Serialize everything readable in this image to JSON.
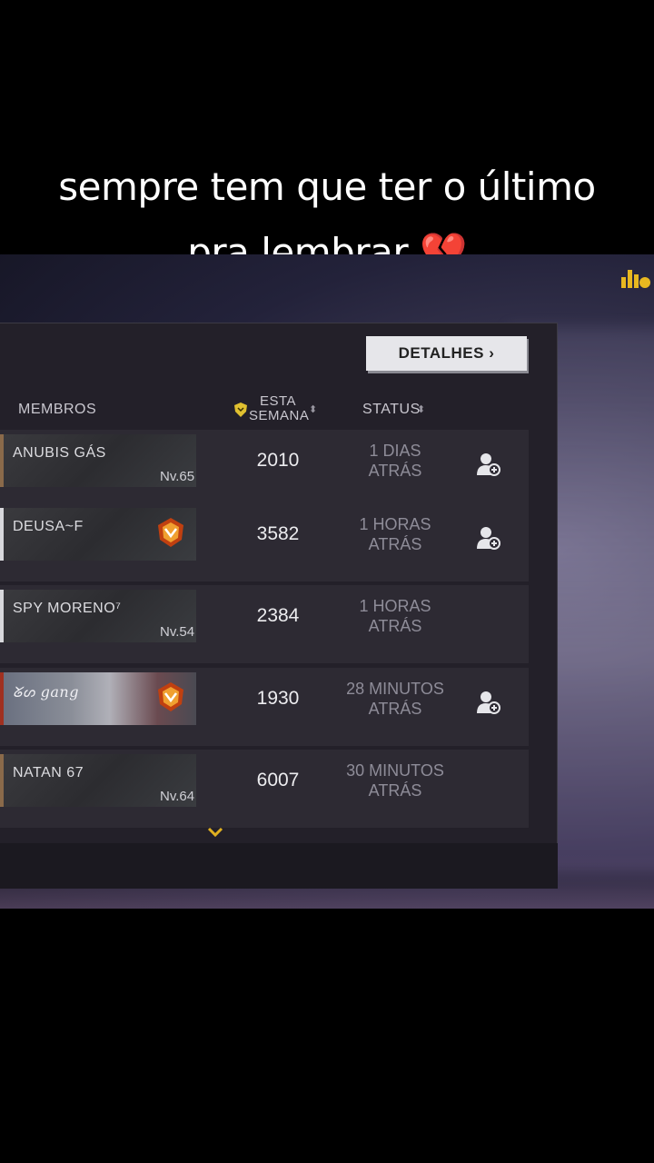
{
  "caption": {
    "line1": "sempre tem que ter o último",
    "line2": "pra lembrar 💔"
  },
  "panel": {
    "details_button": "DETALHES ›",
    "headers": {
      "members": "MEMBROS",
      "week_line1": "ESTA",
      "week_line2": "SEMANA",
      "status": "STATUS",
      "sort_glyph": "⬍"
    },
    "icons": {
      "shield": "shield-icon",
      "add_friend": "add-friend-icon",
      "rank_badge": "rank-badge-icon",
      "chevron": "chevron-down-icon",
      "leaderboard": "leaderboard-icon"
    },
    "rows": [
      {
        "name": "ANUBIS  GÁS",
        "level": "Nv.65",
        "score": "2010",
        "status_line1": "1 DIAS",
        "status_line2": "ATRÁS",
        "has_add": true
      },
      {
        "name": "DEUSA~F",
        "level": "",
        "score": "3582",
        "status_line1": "1 HORAS",
        "status_line2": "ATRÁS",
        "has_add": true
      },
      {
        "name": "SPY  MORENO⁷",
        "level": "Nv.54",
        "score": "2384",
        "status_line1": "1 HORAS",
        "status_line2": "ATRÁS",
        "has_add": false
      },
      {
        "name": "ᘜᔕ gang",
        "level": "",
        "score": "1930",
        "status_line1": "28 MINUTOS",
        "status_line2": "ATRÁS",
        "has_add": true
      },
      {
        "name": "NATAN   67",
        "level": "Nv.64",
        "score": "6007",
        "status_line1": "30 MINUTOS",
        "status_line2": "ATRÁS",
        "has_add": false
      }
    ]
  },
  "colors": {
    "accent_gold": "#e0b020",
    "panel_bg": "#232029",
    "row_bg": "#2d2a33"
  }
}
